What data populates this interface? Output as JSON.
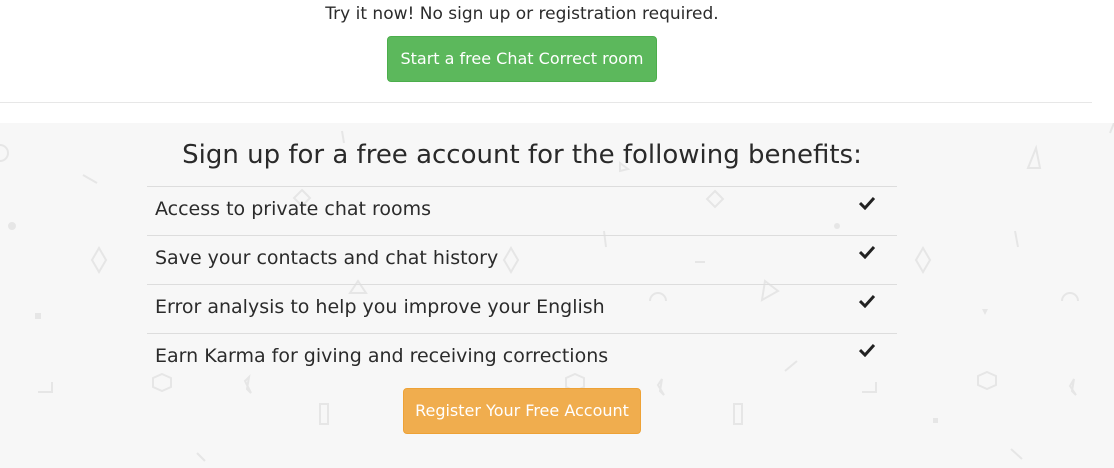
{
  "top": {
    "tagline": "Try it now! No sign up or registration required.",
    "start_button": "Start a free Chat Correct room"
  },
  "benefits": {
    "title": "Sign up for a free account for the following benefits:",
    "items": [
      {
        "label": "Access to private chat rooms",
        "icon": "check-icon"
      },
      {
        "label": "Save your contacts and chat history",
        "icon": "check-icon"
      },
      {
        "label": "Error analysis to help you improve your English",
        "icon": "check-icon"
      },
      {
        "label": "Earn Karma for giving and receiving corrections",
        "icon": "check-icon"
      }
    ],
    "register_button": "Register Your Free Account"
  },
  "colors": {
    "start_button": "#5cb85c",
    "register_button": "#f0ad4e",
    "benefits_background": "#f7f7f7"
  }
}
